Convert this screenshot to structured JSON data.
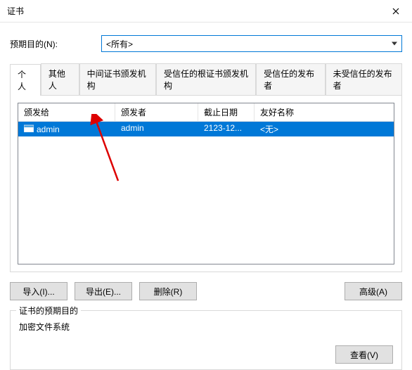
{
  "window": {
    "title": "证书"
  },
  "purpose": {
    "label": "预期目的(N):",
    "selected": "<所有>"
  },
  "tabs": [
    {
      "label": "个人",
      "active": true
    },
    {
      "label": "其他人",
      "active": false
    },
    {
      "label": "中间证书颁发机构",
      "active": false
    },
    {
      "label": "受信任的根证书颁发机构",
      "active": false
    },
    {
      "label": "受信任的发布者",
      "active": false
    },
    {
      "label": "未受信任的发布者",
      "active": false
    }
  ],
  "list": {
    "columns": {
      "issued_to": "颁发给",
      "issued_by": "颁发者",
      "expires": "截止日期",
      "friendly": "友好名称"
    },
    "rows": [
      {
        "issued_to": "admin",
        "issued_by": "admin",
        "expires": "2123-12...",
        "friendly": "<无>"
      }
    ]
  },
  "buttons": {
    "import": "导入(I)...",
    "export": "导出(E)...",
    "remove": "删除(R)",
    "advanced": "高级(A)",
    "view": "查看(V)"
  },
  "group": {
    "title": "证书的预期目的",
    "text": "加密文件系统"
  }
}
